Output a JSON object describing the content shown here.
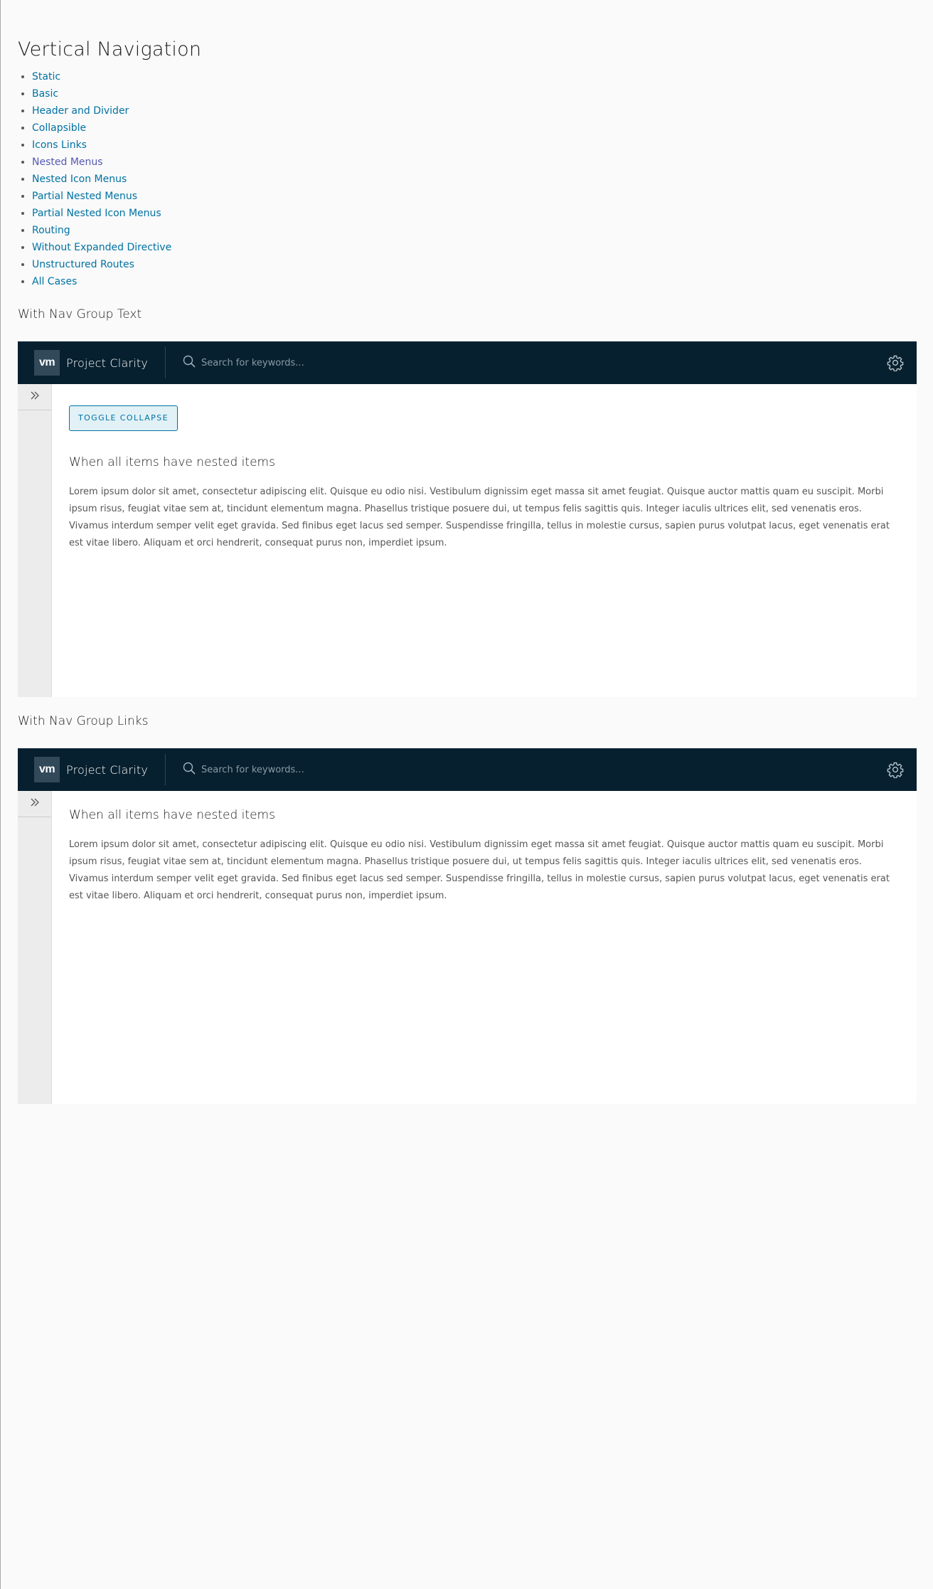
{
  "page": {
    "title": "Vertical Navigation"
  },
  "nav_links": [
    {
      "label": "Static"
    },
    {
      "label": "Basic"
    },
    {
      "label": "Header and Divider"
    },
    {
      "label": "Collapsible"
    },
    {
      "label": "Icons Links"
    },
    {
      "label": "Nested Menus"
    },
    {
      "label": "Nested Icon Menus"
    },
    {
      "label": "Partial Nested Menus"
    },
    {
      "label": "Partial Nested Icon Menus"
    },
    {
      "label": "Routing"
    },
    {
      "label": "Without Expanded Directive"
    },
    {
      "label": "Unstructured Routes"
    },
    {
      "label": "All Cases"
    }
  ],
  "colors": {
    "link": "#0072a3",
    "visited_link": "#5659b6",
    "header_bg": "#06202f",
    "sidenav_bg": "#ececec"
  },
  "demo1": {
    "section_title": "With Nav Group Text",
    "brand": {
      "logo": "vm",
      "title": "Project Clarity"
    },
    "search_placeholder": "Search for keywords...",
    "toggle_label": "TOGGLE COLLAPSE",
    "heading": "When all items have nested items",
    "body": "Lorem ipsum dolor sit amet, consectetur adipiscing elit. Quisque eu odio nisi. Vestibulum dignissim eget massa sit amet feugiat. Quisque auctor mattis quam eu suscipit. Morbi ipsum risus, feugiat vitae sem at, tincidunt elementum magna. Phasellus tristique posuere dui, ut tempus felis sagittis quis. Integer iaculis ultrices elit, sed venenatis eros. Vivamus interdum semper velit eget gravida. Sed finibus eget lacus sed semper. Suspendisse fringilla, tellus in molestie cursus, sapien purus volutpat lacus, eget venenatis erat est vitae libero. Aliquam et orci hendrerit, consequat purus non, imperdiet ipsum."
  },
  "demo2": {
    "section_title": "With Nav Group Links",
    "brand": {
      "logo": "vm",
      "title": "Project Clarity"
    },
    "search_placeholder": "Search for keywords...",
    "heading": "When all items have nested items",
    "body": "Lorem ipsum dolor sit amet, consectetur adipiscing elit. Quisque eu odio nisi. Vestibulum dignissim eget massa sit amet feugiat. Quisque auctor mattis quam eu suscipit. Morbi ipsum risus, feugiat vitae sem at, tincidunt elementum magna. Phasellus tristique posuere dui, ut tempus felis sagittis quis. Integer iaculis ultrices elit, sed venenatis eros. Vivamus interdum semper velit eget gravida. Sed finibus eget lacus sed semper. Suspendisse fringilla, tellus in molestie cursus, sapien purus volutpat lacus, eget venenatis erat est vitae libero. Aliquam et orci hendrerit, consequat purus non, imperdiet ipsum."
  }
}
